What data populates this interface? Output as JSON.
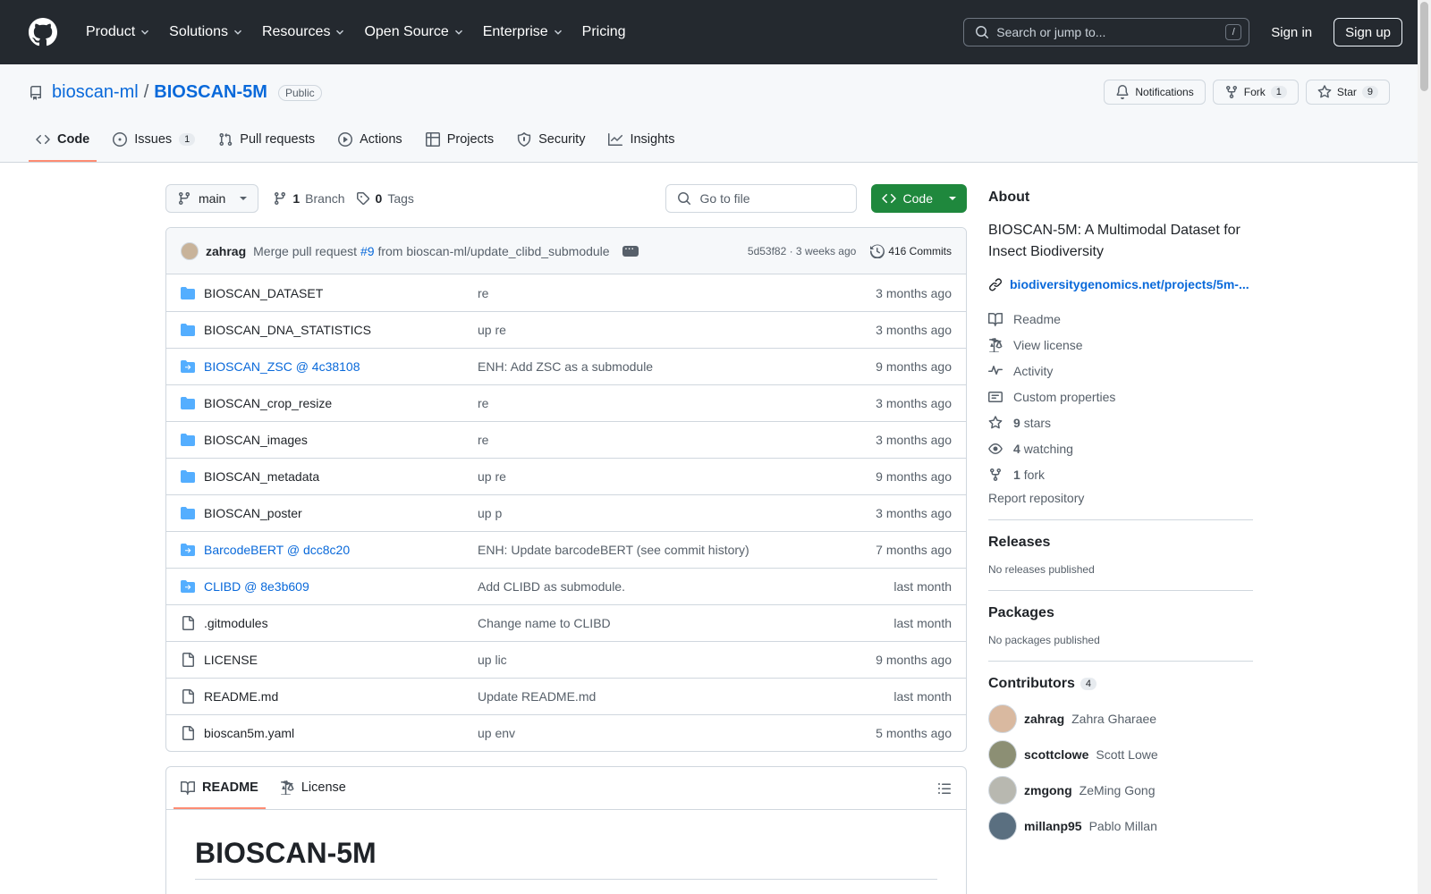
{
  "header": {
    "nav": [
      "Product",
      "Solutions",
      "Resources",
      "Open Source",
      "Enterprise",
      "Pricing"
    ],
    "search_placeholder": "Search or jump to...",
    "search_shortcut": "/",
    "signin": "Sign in",
    "signup": "Sign up"
  },
  "repo": {
    "owner": "bioscan-ml",
    "separator": "/",
    "name": "BIOSCAN-5M",
    "visibility": "Public",
    "notifications": "Notifications",
    "fork_label": "Fork",
    "fork_count": "1",
    "star_label": "Star",
    "star_count": "9"
  },
  "tabs": {
    "code": "Code",
    "issues": "Issues",
    "issues_count": "1",
    "pulls": "Pull requests",
    "actions": "Actions",
    "projects": "Projects",
    "security": "Security",
    "insights": "Insights"
  },
  "toolbar": {
    "branch": "main",
    "branch_count": "1",
    "branch_label": "Branch",
    "tag_count": "0",
    "tag_label": "Tags",
    "goto_placeholder": "Go to file",
    "code_button": "Code"
  },
  "commit": {
    "author": "zahrag",
    "msg_prefix": "Merge pull request",
    "pr": "#9",
    "msg_suffix": "from bioscan-ml/update_clibd_submodule",
    "hash_time": "5d53f82 · 3 weeks ago",
    "commits": "416 Commits"
  },
  "files": [
    {
      "name": "BIOSCAN_DATASET",
      "type": "dir",
      "msg": "re",
      "date": "3 months ago"
    },
    {
      "name": "BIOSCAN_DNA_STATISTICS",
      "type": "dir",
      "msg": "up re",
      "date": "3 months ago"
    },
    {
      "name": "BIOSCAN_ZSC @ 4c38108",
      "type": "sub",
      "msg": "ENH: Add ZSC as a submodule",
      "date": "9 months ago"
    },
    {
      "name": "BIOSCAN_crop_resize",
      "type": "dir",
      "msg": "re",
      "date": "3 months ago"
    },
    {
      "name": "BIOSCAN_images",
      "type": "dir",
      "msg": "re",
      "date": "3 months ago"
    },
    {
      "name": "BIOSCAN_metadata",
      "type": "dir",
      "msg": "up re",
      "date": "9 months ago"
    },
    {
      "name": "BIOSCAN_poster",
      "type": "dir",
      "msg": "up p",
      "date": "3 months ago"
    },
    {
      "name": "BarcodeBERT @ dcc8c20",
      "type": "sub",
      "msg": "ENH: Update barcodeBERT (see commit history)",
      "date": "7 months ago"
    },
    {
      "name": "CLIBD @ 8e3b609",
      "type": "sub",
      "msg": "Add CLIBD as submodule.",
      "date": "last month"
    },
    {
      "name": ".gitmodules",
      "type": "file",
      "msg": "Change name to CLIBD",
      "date": "last month"
    },
    {
      "name": "LICENSE",
      "type": "file",
      "msg": "up lic",
      "date": "9 months ago"
    },
    {
      "name": "README.md",
      "type": "file",
      "msg": "Update README.md",
      "date": "last month"
    },
    {
      "name": "bioscan5m.yaml",
      "type": "file",
      "msg": "up env",
      "date": "5 months ago"
    }
  ],
  "readme": {
    "tab_readme": "README",
    "tab_license": "License",
    "heading": "BIOSCAN-5M"
  },
  "about": {
    "title": "About",
    "description": "BIOSCAN-5M: A Multimodal Dataset for Insect Biodiversity",
    "link": "biodiversitygenomics.net/projects/5m-...",
    "readme": "Readme",
    "license": "View license",
    "activity": "Activity",
    "custom": "Custom properties",
    "stars_count": "9",
    "stars_label": "stars",
    "watching_count": "4",
    "watching_label": "watching",
    "fork_count": "1",
    "fork_label": "fork",
    "report": "Report repository"
  },
  "releases": {
    "title": "Releases",
    "note": "No releases published"
  },
  "packages": {
    "title": "Packages",
    "note": "No packages published"
  },
  "contributors": {
    "title": "Contributors",
    "count": "4",
    "list": [
      {
        "login": "zahrag",
        "name": "Zahra Gharaee",
        "color": "#d9b9a0"
      },
      {
        "login": "scottclowe",
        "name": "Scott Lowe",
        "color": "#8c8f74"
      },
      {
        "login": "zmgong",
        "name": "ZeMing Gong",
        "color": "#b8b8b0"
      },
      {
        "login": "millanp95",
        "name": "Pablo Millan",
        "color": "#5a6f80"
      }
    ]
  }
}
